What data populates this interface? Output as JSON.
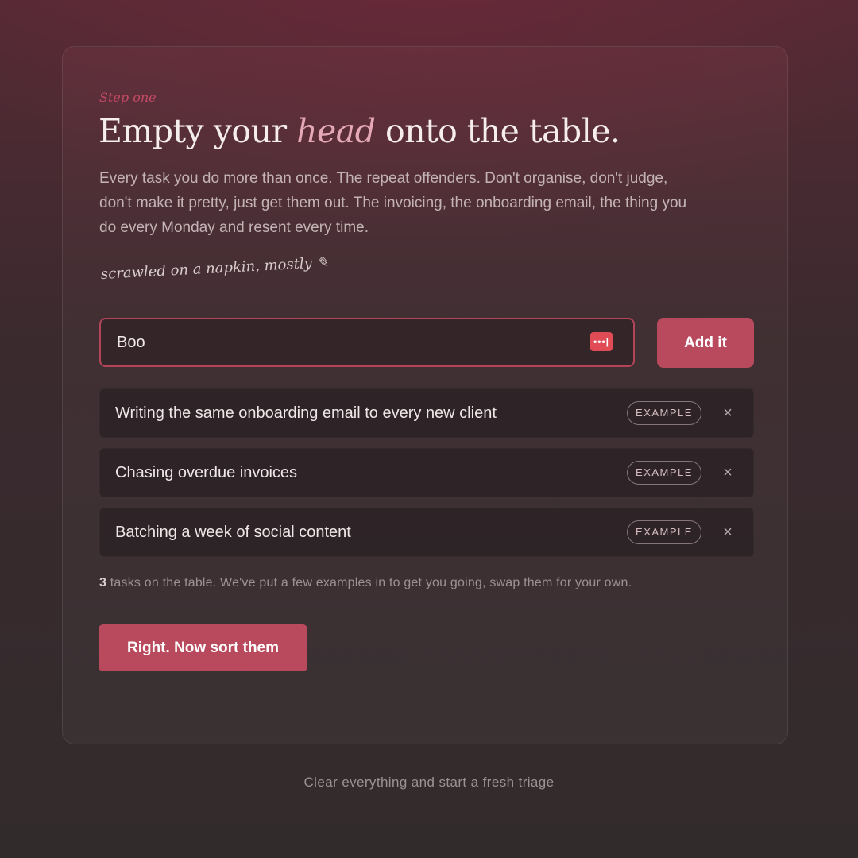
{
  "intro": {
    "eyebrow": "Step one",
    "title_before": "Empty your ",
    "title_emphasis": "head",
    "title_after": " onto the table.",
    "lede": "Every task you do more than once. The repeat offenders. Don't organise, don't judge, don't make it pretty, just get them out. The invoicing, the onboarding email, the thing you do every Monday and resent every time.",
    "scrawl": "scrawled on a napkin, mostly",
    "pencil_icon": "✎"
  },
  "entry": {
    "input_value": "Boo",
    "password_icon": "•••|",
    "add_label": "Add it"
  },
  "tasks": [
    {
      "text": "Writing the same onboarding email to every new client",
      "badge": "EXAMPLE",
      "remove_icon": "×"
    },
    {
      "text": "Chasing overdue invoices",
      "badge": "EXAMPLE",
      "remove_icon": "×"
    },
    {
      "text": "Batching a week of social content",
      "badge": "EXAMPLE",
      "remove_icon": "×"
    }
  ],
  "summary": {
    "count": "3",
    "text": " tasks on the table. We've put a few examples in to get you going, swap them for your own."
  },
  "actions": {
    "sort_label": "Right. Now sort them",
    "reset_label": "Clear everything and start a fresh triage"
  },
  "colors": {
    "accent": "#b94a5d",
    "eyebrow": "#c44a64",
    "title_emphasis": "#e5a8b6"
  }
}
